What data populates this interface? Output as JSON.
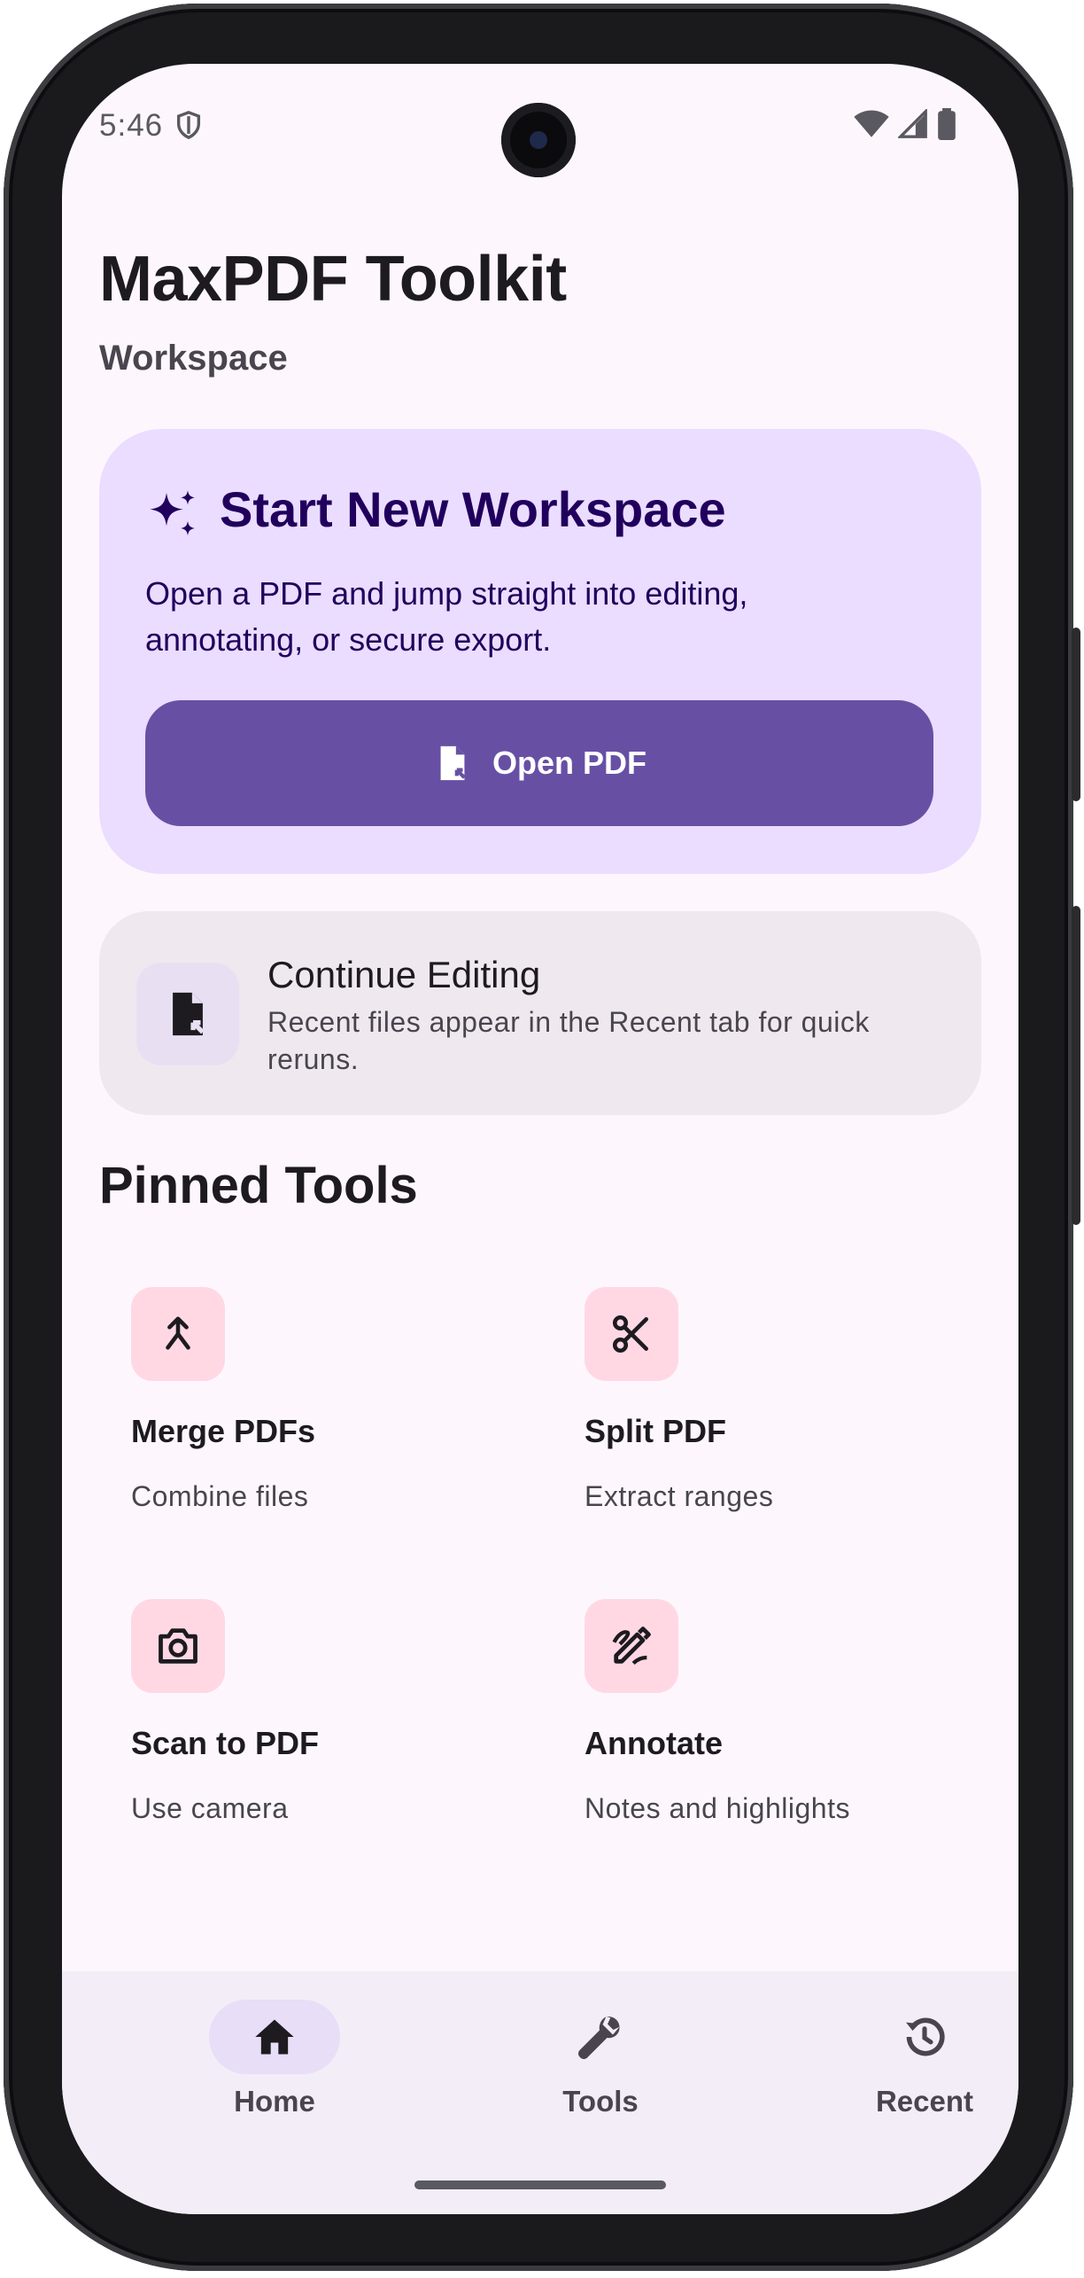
{
  "status_bar": {
    "time": "5:46"
  },
  "app": {
    "title": "MaxPDF Toolkit",
    "subtitle": "Workspace"
  },
  "hero": {
    "title": "Start New Workspace",
    "description": "Open a PDF and jump straight into editing, annotating, or secure export.",
    "button_label": "Open PDF",
    "icon": "sparkle-icon",
    "button_icon": "file-open-icon"
  },
  "continue": {
    "title": "Continue Editing",
    "description": "Recent files appear in the Recent tab for quick reruns.",
    "icon": "file-open-icon"
  },
  "pinned": {
    "title": "Pinned Tools",
    "tools": [
      {
        "name": "Merge PDFs",
        "desc": "Combine files",
        "icon": "merge-icon"
      },
      {
        "name": "Split PDF",
        "desc": "Extract ranges",
        "icon": "scissors-icon"
      },
      {
        "name": "Scan to PDF",
        "desc": "Use camera",
        "icon": "camera-icon"
      },
      {
        "name": "Annotate",
        "desc": "Notes and highlights",
        "icon": "draw-icon"
      }
    ]
  },
  "nav": {
    "items": [
      {
        "label": "Home",
        "icon": "home-icon",
        "active": true
      },
      {
        "label": "Tools",
        "icon": "wrench-icon",
        "active": false
      },
      {
        "label": "Recent",
        "icon": "history-icon",
        "active": false
      }
    ]
  },
  "colors": {
    "background": "#fdf7fd",
    "hero_container": "#eaddff",
    "primary": "#6750a4",
    "on_primary_container": "#21005d",
    "tool_icon_container": "#ffd8e4",
    "nav_bar": "#f3edf7"
  }
}
